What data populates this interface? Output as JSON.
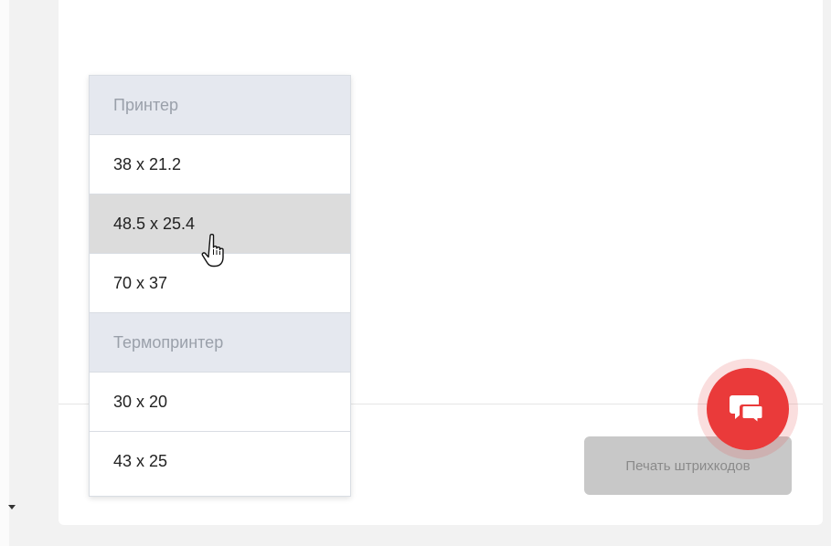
{
  "dropdown": {
    "groups": [
      {
        "label": "Принтер",
        "options": [
          "38 x 21.2",
          "48.5 x 25.4",
          "70 x 37"
        ]
      },
      {
        "label": "Термопринтер",
        "options": [
          "30 x 20",
          "43 x 25"
        ]
      }
    ],
    "hovered_option": "48.5 x 25.4"
  },
  "actions": {
    "print_barcodes_label": "Печать штрихкодов"
  },
  "icons": {
    "chat": "chat-bubbles-icon",
    "caret": "caret-down-icon",
    "cursor": "hand-pointer-icon"
  },
  "colors": {
    "fab": "#ea3a3a",
    "button_disabled_bg": "#c8c8c8",
    "group_header_bg": "#e5e8ef",
    "hover_bg": "#dcdcdc"
  }
}
